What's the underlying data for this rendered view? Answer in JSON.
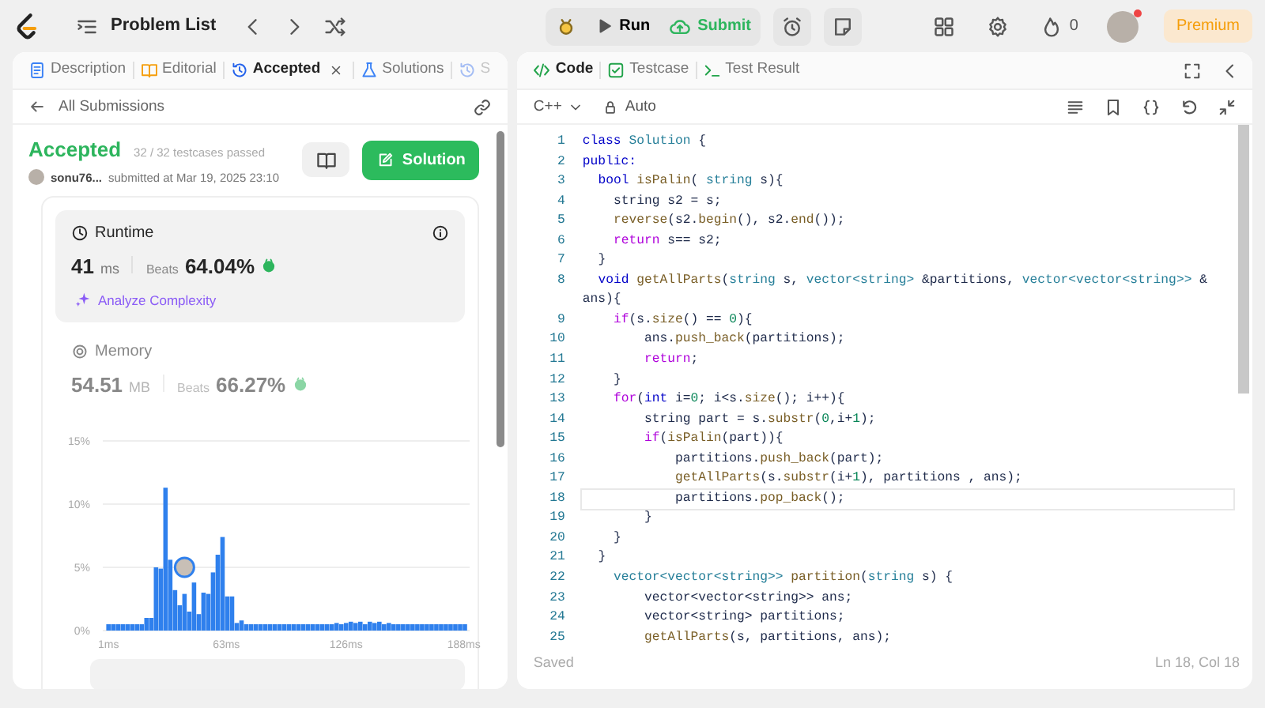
{
  "topbar": {
    "title": "Problem List",
    "run": "Run",
    "submit": "Submit",
    "streak": "0",
    "premium": "Premium"
  },
  "left_tabs": [
    {
      "label": "Description",
      "selected": false,
      "closable": false,
      "cut": false
    },
    {
      "label": "Editorial",
      "selected": false,
      "closable": false,
      "cut": false
    },
    {
      "label": "Accepted",
      "selected": true,
      "closable": true,
      "cut": false
    },
    {
      "label": "Solutions",
      "selected": false,
      "closable": false,
      "cut": false
    },
    {
      "label": "S",
      "selected": false,
      "closable": false,
      "cut": true
    }
  ],
  "right_tabs": [
    {
      "label": "Code",
      "selected": true
    },
    {
      "label": "Testcase",
      "selected": false
    },
    {
      "label": "Test Result",
      "selected": false
    }
  ],
  "submission": {
    "back": "All Submissions",
    "status": "Accepted",
    "testcases": "32 / 32 testcases passed",
    "user": "sonu76...",
    "submitted": "submitted at Mar 19, 2025 23:10",
    "solution_button": "Solution"
  },
  "metrics": [
    {
      "kind": "runtime",
      "label": "Runtime",
      "value": "41",
      "unit": "ms",
      "beats_label": "Beats",
      "beats": "64.04%",
      "analyze": "Analyze Complexity",
      "selected": true
    },
    {
      "kind": "memory",
      "label": "Memory",
      "value": "54.51",
      "unit": "MB",
      "beats_label": "Beats",
      "beats": "66.27%",
      "selected": false
    }
  ],
  "chart_data": {
    "type": "bar",
    "x": [
      1,
      3.5,
      6,
      8.5,
      11,
      13.5,
      16,
      18.5,
      21,
      23.5,
      26,
      28.5,
      31,
      33.5,
      36,
      38.5,
      41,
      43.5,
      46,
      48.5,
      51,
      53.5,
      56,
      58.5,
      61,
      63.5,
      66,
      68.5,
      71,
      73.5,
      76,
      78.5,
      81,
      83.5,
      86,
      88.5,
      91,
      93.5,
      96,
      98.5,
      101,
      103.5,
      106,
      108.5,
      111,
      113.5,
      116,
      118.5,
      121,
      123.5,
      126,
      128.5,
      131,
      133.5,
      136,
      138.5,
      141,
      143.5,
      146,
      148.5,
      151,
      153.5,
      156,
      158.5,
      161,
      163.5,
      166,
      168.5,
      171,
      173.5,
      176,
      178.5,
      181,
      183.5,
      186,
      188.5
    ],
    "values": [
      0.5,
      0.5,
      0.5,
      0.5,
      0.5,
      0.5,
      0.5,
      0.5,
      1.0,
      1.0,
      5.0,
      4.9,
      11.3,
      5.6,
      3.2,
      2.0,
      2.9,
      1.5,
      3.8,
      1.3,
      3.0,
      2.9,
      4.6,
      6.0,
      7.4,
      2.7,
      2.7,
      0.6,
      0.8,
      0.5,
      0.5,
      0.5,
      0.5,
      0.5,
      0.5,
      0.5,
      0.5,
      0.5,
      0.5,
      0.5,
      0.5,
      0.5,
      0.5,
      0.5,
      0.5,
      0.5,
      0.5,
      0.5,
      0.6,
      0.5,
      0.6,
      0.7,
      0.6,
      0.7,
      0.5,
      0.7,
      0.6,
      0.7,
      0.5,
      0.6,
      0.5,
      0.5,
      0.5,
      0.5,
      0.5,
      0.5,
      0.5,
      0.5,
      0.5,
      0.5,
      0.5,
      0.5,
      0.5,
      0.5,
      0.5,
      0.5
    ],
    "xlim": [
      -2,
      191
    ],
    "ylim": [
      0,
      15
    ],
    "xticks": [
      {
        "value": 1,
        "label": "1ms"
      },
      {
        "value": 63,
        "label": "63ms"
      },
      {
        "value": 126,
        "label": "126ms"
      },
      {
        "value": 188,
        "label": "188ms"
      }
    ],
    "yticks": [
      {
        "value": 0,
        "label": "0%"
      },
      {
        "value": 5,
        "label": "5%"
      },
      {
        "value": 10,
        "label": "10%"
      },
      {
        "value": 15,
        "label": "15%"
      }
    ]
  },
  "editor": {
    "language": "C++",
    "mode": "Auto",
    "status": "Saved",
    "cursor": "Ln 18, Col 18",
    "lines": [
      {
        "num": "1",
        "current": false,
        "tokens": [
          {
            "kind": "keyword",
            "text": "class "
          },
          {
            "kind": "type",
            "text": "Solution"
          },
          {
            "kind": "plain",
            "text": " {"
          }
        ]
      },
      {
        "num": "2",
        "current": false,
        "tokens": [
          {
            "kind": "keyword",
            "text": "public:"
          }
        ]
      },
      {
        "num": "3",
        "current": false,
        "tokens": [
          {
            "kind": "keyword",
            "text": "  bool "
          },
          {
            "kind": "function",
            "text": "isPalin"
          },
          {
            "kind": "plain",
            "text": "( "
          },
          {
            "kind": "type",
            "text": "string"
          },
          {
            "kind": "plain",
            "text": " s){"
          }
        ]
      },
      {
        "num": "4",
        "current": false,
        "tokens": [
          {
            "kind": "plain",
            "text": "    string s2 = s;"
          }
        ]
      },
      {
        "num": "5",
        "current": false,
        "tokens": [
          {
            "kind": "function",
            "text": "    reverse"
          },
          {
            "kind": "plain",
            "text": "(s2."
          },
          {
            "kind": "function",
            "text": "begin"
          },
          {
            "kind": "plain",
            "text": "(), s2."
          },
          {
            "kind": "function",
            "text": "end"
          },
          {
            "kind": "plain",
            "text": "());"
          }
        ]
      },
      {
        "num": "6",
        "current": false,
        "tokens": [
          {
            "kind": "control",
            "text": "    return"
          },
          {
            "kind": "plain",
            "text": " s== s2;"
          }
        ]
      },
      {
        "num": "7",
        "current": false,
        "tokens": [
          {
            "kind": "plain",
            "text": "  }"
          }
        ]
      },
      {
        "num": "8",
        "current": false,
        "tokens": [
          {
            "kind": "keyword",
            "text": "  void "
          },
          {
            "kind": "function",
            "text": "getAllParts"
          },
          {
            "kind": "plain",
            "text": "("
          },
          {
            "kind": "type",
            "text": "string"
          },
          {
            "kind": "plain",
            "text": " s, "
          },
          {
            "kind": "type",
            "text": "vector<string>"
          },
          {
            "kind": "plain",
            "text": " &partitions, "
          },
          {
            "kind": "type",
            "text": "vector<vector<string>>"
          },
          {
            "kind": "plain",
            "text": " & ans){"
          }
        ]
      },
      {
        "num": "9",
        "current": false,
        "tokens": [
          {
            "kind": "control",
            "text": "    if"
          },
          {
            "kind": "plain",
            "text": "(s."
          },
          {
            "kind": "function",
            "text": "size"
          },
          {
            "kind": "plain",
            "text": "() == "
          },
          {
            "kind": "number",
            "text": "0"
          },
          {
            "kind": "plain",
            "text": "){"
          }
        ]
      },
      {
        "num": "10",
        "current": false,
        "tokens": [
          {
            "kind": "plain",
            "text": "        ans."
          },
          {
            "kind": "function",
            "text": "push_back"
          },
          {
            "kind": "plain",
            "text": "(partitions);"
          }
        ]
      },
      {
        "num": "11",
        "current": false,
        "tokens": [
          {
            "kind": "control",
            "text": "        return"
          },
          {
            "kind": "plain",
            "text": ";"
          }
        ]
      },
      {
        "num": "12",
        "current": false,
        "tokens": [
          {
            "kind": "plain",
            "text": "    }"
          }
        ]
      },
      {
        "num": "13",
        "current": false,
        "tokens": [
          {
            "kind": "control",
            "text": "    for"
          },
          {
            "kind": "plain",
            "text": "("
          },
          {
            "kind": "keyword",
            "text": "int"
          },
          {
            "kind": "plain",
            "text": " i="
          },
          {
            "kind": "number",
            "text": "0"
          },
          {
            "kind": "plain",
            "text": "; i<s."
          },
          {
            "kind": "function",
            "text": "size"
          },
          {
            "kind": "plain",
            "text": "(); i++){"
          }
        ]
      },
      {
        "num": "14",
        "current": false,
        "tokens": [
          {
            "kind": "plain",
            "text": "        string part = s."
          },
          {
            "kind": "function",
            "text": "substr"
          },
          {
            "kind": "plain",
            "text": "("
          },
          {
            "kind": "number",
            "text": "0"
          },
          {
            "kind": "plain",
            "text": ",i+"
          },
          {
            "kind": "number",
            "text": "1"
          },
          {
            "kind": "plain",
            "text": ");"
          }
        ]
      },
      {
        "num": "15",
        "current": false,
        "tokens": [
          {
            "kind": "control",
            "text": "        if"
          },
          {
            "kind": "plain",
            "text": "("
          },
          {
            "kind": "function",
            "text": "isPalin"
          },
          {
            "kind": "plain",
            "text": "(part)){"
          }
        ]
      },
      {
        "num": "16",
        "current": false,
        "tokens": [
          {
            "kind": "plain",
            "text": "            partitions."
          },
          {
            "kind": "function",
            "text": "push_back"
          },
          {
            "kind": "plain",
            "text": "(part);"
          }
        ]
      },
      {
        "num": "17",
        "current": false,
        "tokens": [
          {
            "kind": "function",
            "text": "            getAllParts"
          },
          {
            "kind": "plain",
            "text": "(s."
          },
          {
            "kind": "function",
            "text": "substr"
          },
          {
            "kind": "plain",
            "text": "(i+"
          },
          {
            "kind": "number",
            "text": "1"
          },
          {
            "kind": "plain",
            "text": "), partitions , ans);"
          }
        ]
      },
      {
        "num": "18",
        "current": true,
        "tokens": [
          {
            "kind": "plain",
            "text": "            partitions."
          },
          {
            "kind": "function",
            "text": "pop_back"
          },
          {
            "kind": "plain",
            "text": "();"
          }
        ]
      },
      {
        "num": "19",
        "current": false,
        "tokens": [
          {
            "kind": "plain",
            "text": "        }"
          }
        ]
      },
      {
        "num": "20",
        "current": false,
        "tokens": [
          {
            "kind": "plain",
            "text": "    }"
          }
        ]
      },
      {
        "num": "21",
        "current": false,
        "tokens": [
          {
            "kind": "plain",
            "text": "  }"
          }
        ]
      },
      {
        "num": "22",
        "current": false,
        "tokens": [
          {
            "kind": "type",
            "text": "    vector<vector<string>>"
          },
          {
            "kind": "function",
            "text": " partition"
          },
          {
            "kind": "plain",
            "text": "("
          },
          {
            "kind": "type",
            "text": "string"
          },
          {
            "kind": "plain",
            "text": " s) {"
          }
        ]
      },
      {
        "num": "23",
        "current": false,
        "tokens": [
          {
            "kind": "plain",
            "text": "        vector<vector<string>> ans;"
          }
        ]
      },
      {
        "num": "24",
        "current": false,
        "tokens": [
          {
            "kind": "plain",
            "text": "        vector<string> partitions;"
          }
        ]
      },
      {
        "num": "25",
        "current": false,
        "tokens": [
          {
            "kind": "function",
            "text": "        getAllParts"
          },
          {
            "kind": "plain",
            "text": "(s, partitions, ans);"
          }
        ]
      }
    ]
  }
}
